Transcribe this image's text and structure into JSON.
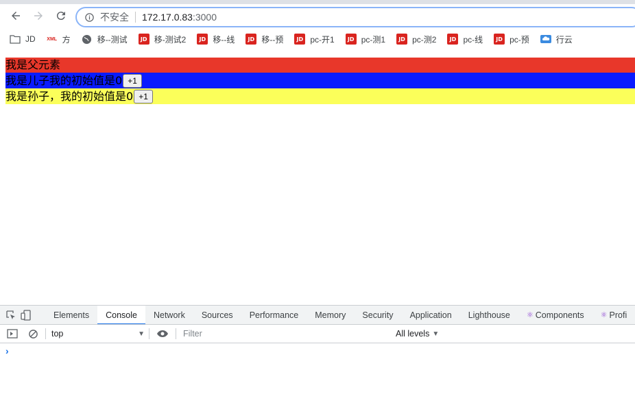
{
  "browser": {
    "security_label": "不安全",
    "url_host": "172.17.0.83",
    "url_port": ":3000"
  },
  "bookmarks": [
    {
      "label": "JD",
      "icon": "folder-icon"
    },
    {
      "label": "方",
      "icon": "xml-icon"
    },
    {
      "label": "移--测试",
      "icon": "globe-icon"
    },
    {
      "label": "移-测试2",
      "icon": "jd-icon"
    },
    {
      "label": "移--线",
      "icon": "jd-icon"
    },
    {
      "label": "移--预",
      "icon": "jd-icon"
    },
    {
      "label": "pc-开1",
      "icon": "jd-icon"
    },
    {
      "label": "pc-测1",
      "icon": "jd-icon"
    },
    {
      "label": "pc-测2",
      "icon": "jd-icon"
    },
    {
      "label": "pc-线",
      "icon": "jd-icon"
    },
    {
      "label": "pc-预",
      "icon": "jd-icon"
    },
    {
      "label": "行云",
      "icon": "cloud-icon"
    }
  ],
  "icons": {
    "jd_text": "JD",
    "xml_text": "XML"
  },
  "page": {
    "parent_text": "我是父元素",
    "child_text": "我是儿子我的初始值是0",
    "child_button": "+1",
    "grandchild_text": "我是孙子，我的初始值是0",
    "grandchild_button": "+1",
    "colors": {
      "parent": "#e8372a",
      "child": "#0a1bff",
      "grandchild": "#fbff5a"
    }
  },
  "devtools": {
    "tabs": [
      "Elements",
      "Console",
      "Network",
      "Sources",
      "Performance",
      "Memory",
      "Security",
      "Application",
      "Lighthouse",
      "Components",
      "Profi"
    ],
    "active_tab": "Console",
    "context": "top",
    "filter_placeholder": "Filter",
    "levels": "All levels",
    "prompt": "›"
  }
}
